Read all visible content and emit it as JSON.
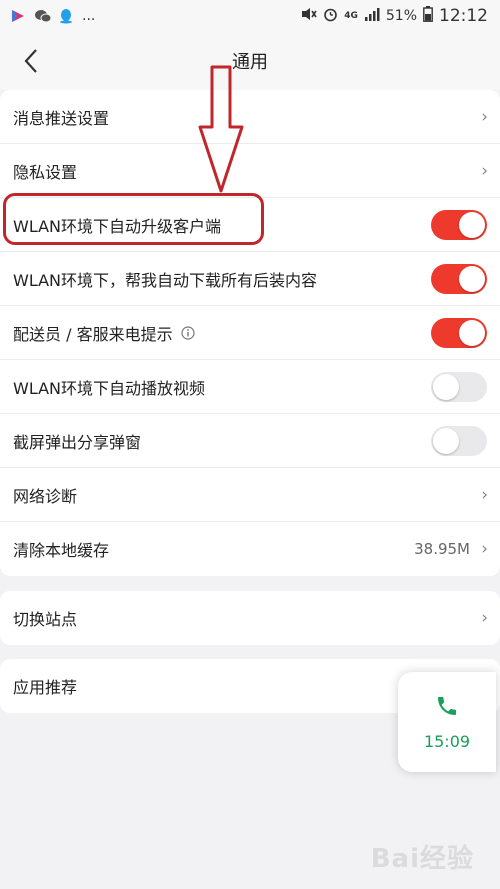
{
  "status_bar": {
    "left_more": "...",
    "network": "4G",
    "battery": "51%",
    "time": "12:12"
  },
  "nav": {
    "title": "通用"
  },
  "groups": [
    {
      "rows": [
        {
          "label": "消息推送设置",
          "type": "link"
        },
        {
          "label": "隐私设置",
          "type": "link"
        },
        {
          "label": "WLAN环境下自动升级客户端",
          "type": "toggle",
          "on": true
        },
        {
          "label": "WLAN环境下，帮我自动下载所有后装内容",
          "type": "toggle",
          "on": true
        },
        {
          "label": "配送员 / 客服来电提示",
          "type": "toggle",
          "on": true,
          "info_icon": "info-icon"
        },
        {
          "label": "WLAN环境下自动播放视频",
          "type": "toggle",
          "on": false
        },
        {
          "label": "截屏弹出分享弹窗",
          "type": "toggle",
          "on": false
        },
        {
          "label": "网络诊断",
          "type": "link"
        },
        {
          "label": "清除本地缓存",
          "type": "link",
          "value": "38.95M"
        }
      ]
    },
    {
      "rows": [
        {
          "label": "切换站点",
          "type": "link"
        }
      ]
    },
    {
      "rows": [
        {
          "label": "应用推荐",
          "type": "link"
        }
      ]
    }
  ],
  "call_widget": {
    "time": "15:09",
    "icon": "phone-icon"
  },
  "watermark": "Bai经验",
  "colors": {
    "toggle_on": "#ee3a2d",
    "toggle_off": "#e9e9ec",
    "call_green": "#19a05a",
    "annotation_red": "#c0272d"
  }
}
